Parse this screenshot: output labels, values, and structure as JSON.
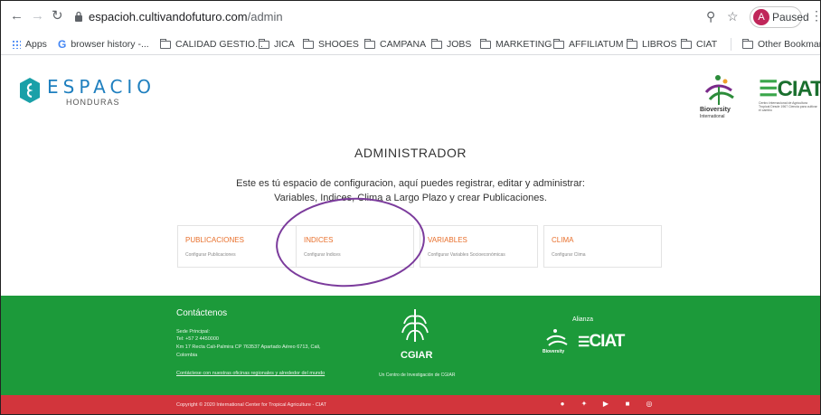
{
  "browser": {
    "url_host": "espacioh.cultivandofuturo.com",
    "url_path": "/admin",
    "profile_initial": "A",
    "profile_status": "Paused"
  },
  "bookmarks": [
    {
      "label": "Apps",
      "icon": "apps-grid-icon"
    },
    {
      "label": "browser history -...",
      "icon": "google-icon"
    },
    {
      "label": "CALIDAD GESTIO...",
      "icon": "folder-icon"
    },
    {
      "label": "JICA",
      "icon": "folder-icon"
    },
    {
      "label": "SHOOES",
      "icon": "folder-icon"
    },
    {
      "label": "CAMPANA",
      "icon": "folder-icon"
    },
    {
      "label": "JOBS",
      "icon": "folder-icon"
    },
    {
      "label": "MARKETING",
      "icon": "folder-icon"
    },
    {
      "label": "AFFILIATUM",
      "icon": "folder-icon"
    },
    {
      "label": "LIBROS",
      "icon": "folder-icon"
    },
    {
      "label": "CIAT",
      "icon": "folder-icon"
    },
    {
      "label": "Other Bookmarks",
      "icon": "folder-icon"
    }
  ],
  "header": {
    "brand": "ESPACIO",
    "brand_sub": "HONDURAS",
    "partner1": "Bioversity",
    "partner1_sub": "International",
    "partner2": "CIAT",
    "partner2_sub": "Centro Internacional de Agricultura Tropical Desde 1967 Ciencia para cultivar el cambio"
  },
  "main": {
    "title": "ADMINISTRADOR",
    "desc_line1": "Este es tú espacio de configuracion, aquí puedes registrar, editar y administrar:",
    "desc_line2": "Variables, Indices, Clima a Largo Plazo y crear Publicaciones.",
    "cards": [
      {
        "title": "PUBLICACIONES",
        "sub": "Configurar Publicaciones"
      },
      {
        "title": "INDICES",
        "sub": "Configurar Indices"
      },
      {
        "title": "VARIABLES",
        "sub": "Configurar Variables Socioeconómicas"
      },
      {
        "title": "CLIMA",
        "sub": "Configurar Clima"
      }
    ]
  },
  "footer": {
    "contact_title": "Contáctenos",
    "address_lines": [
      "Sede Principal:",
      "Tel: +57 2 4450000",
      "Km 17 Recta Cali-Palmira CP 763537 Apartado Aéreo 6713, Cali,",
      "Colombia"
    ],
    "offices_link": "Contáctese con nuestras oficinas regionales y alrededor del mundo",
    "cgiar": "CGIAR",
    "cgiar_sub": "Un Centro de Investigación de CGIAR",
    "alliance": "Alianza",
    "alliance_bio": "Bioversity",
    "alliance_ciat": "CIAT",
    "copyright": "Copyright © 2020 International Center for Tropical Agriculture - CIAT"
  },
  "colors": {
    "footer_green": "#1c9a3a",
    "footer_red": "#d2353c",
    "card_accent": "#e86f2b",
    "annotation_purple": "#7b3b9c",
    "brand_blue": "#1e7fbf"
  }
}
